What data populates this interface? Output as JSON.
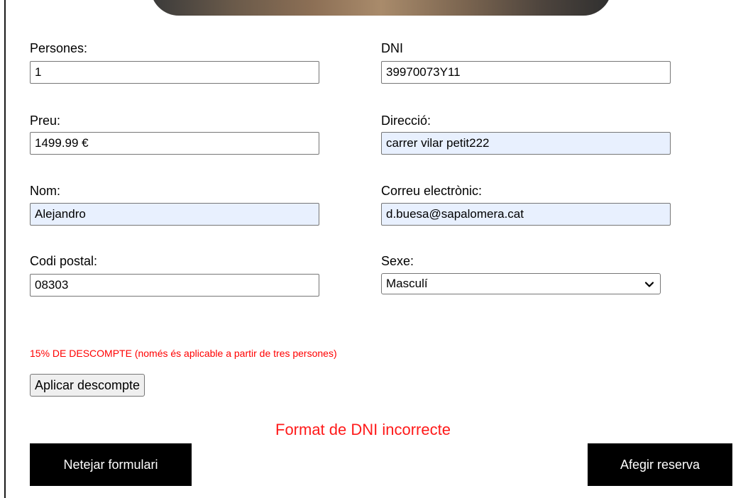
{
  "form": {
    "personas": {
      "label": "Persones:",
      "value": "1"
    },
    "dni": {
      "label": "DNI",
      "value": "39970073Y11"
    },
    "preu": {
      "label": "Preu:",
      "value": "1499.99 €"
    },
    "direccio": {
      "label": "Direcció:",
      "value": "carrer vilar petit222"
    },
    "nom": {
      "label": "Nom:",
      "value": "Alejandro"
    },
    "correu": {
      "label": "Correu electrònic:",
      "value": "d.buesa@sapalomera.cat"
    },
    "codi_postal": {
      "label": "Codi postal:",
      "value": "08303"
    },
    "sexe": {
      "label": "Sexe:",
      "selected": "Masculí"
    }
  },
  "discount": {
    "note": "15% DE DESCOMPTE (només és aplicable a partir de tres persones)",
    "button_label": "Aplicar descompte"
  },
  "validation": {
    "error": "Format de DNI incorrecte"
  },
  "actions": {
    "clear_label": "Netejar formulari",
    "add_label": "Afegir reserva"
  },
  "colors": {
    "error": "#ff1a1a",
    "autofill_bg": "#e8f0fe",
    "action_bg": "#000000"
  }
}
